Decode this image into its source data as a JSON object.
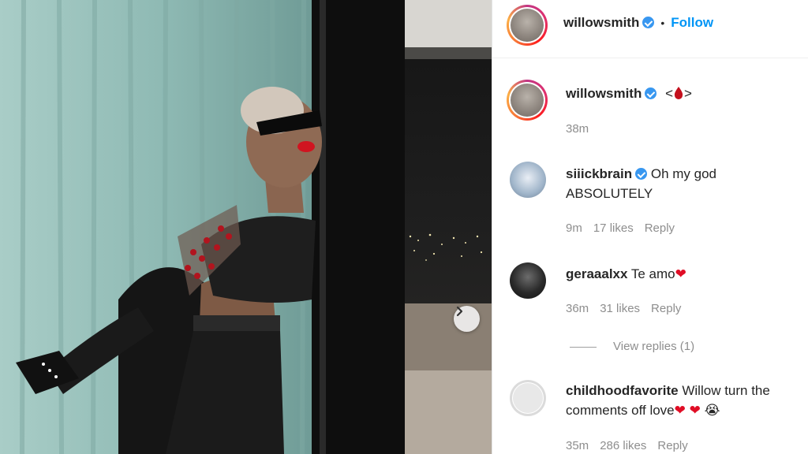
{
  "post": {
    "author": "willowsmith",
    "follow_label": "Follow",
    "separator": "•"
  },
  "caption": {
    "author": "willowsmith",
    "text_left": "<",
    "text_emoji": "blood-drop",
    "text_right": ">",
    "time": "38m"
  },
  "comments": [
    {
      "author": "siiickbrain",
      "verified": true,
      "text": "Oh my god ABSOLUTELY",
      "time": "9m",
      "likes": "17 likes",
      "reply_label": "Reply"
    },
    {
      "author": "geraaalxx",
      "verified": false,
      "text": "Te amo",
      "emoji": "❤",
      "time": "36m",
      "likes": "31 likes",
      "reply_label": "Reply",
      "view_replies": "View replies (1)"
    },
    {
      "author": "childhoodfavorite",
      "verified": false,
      "text_line1": "Willow turn the",
      "text_line2": "comments off love",
      "emoji1": "❤",
      "emoji2": "❤",
      "emoji3": "😭",
      "time": "35m",
      "likes": "286 likes",
      "reply_label": "Reply"
    }
  ],
  "colors": {
    "link": "#0095f6",
    "verified": "#3897f0",
    "muted": "#8e8e8e",
    "heart": "#e00d25"
  }
}
